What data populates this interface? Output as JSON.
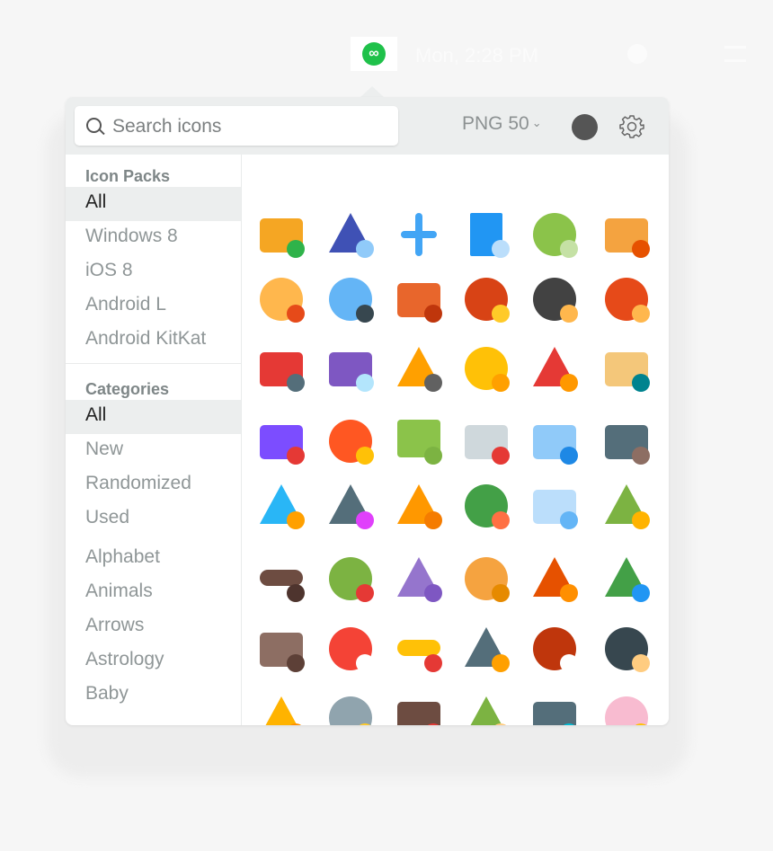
{
  "menubar": {
    "app_icon": "infinity-icon",
    "app_icon_color": "#1fc14a",
    "app_icon_glyph": "∞",
    "datetime": "Mon, 2:28 PM"
  },
  "toolbar": {
    "search_placeholder": "Search icons",
    "format": "PNG 50",
    "color_swatch": "#555555"
  },
  "sidebar": {
    "packs_heading": "Icon Packs",
    "packs": [
      {
        "label": "All",
        "selected": true
      },
      {
        "label": "Windows 8"
      },
      {
        "label": "iOS 8"
      },
      {
        "label": "Android L"
      },
      {
        "label": "Android KitKat"
      }
    ],
    "categories_heading": "Categories",
    "categories": [
      {
        "label": "All",
        "selected": true
      },
      {
        "label": "New"
      },
      {
        "label": "Randomized"
      },
      {
        "label": "Used"
      },
      {
        "label": "Alphabet"
      },
      {
        "label": "Animals"
      },
      {
        "label": "Arrows"
      },
      {
        "label": "Astrology"
      },
      {
        "label": "Baby"
      }
    ]
  },
  "icons": [
    {
      "name": "add-ticket-icon",
      "c1": "#f5a623",
      "c2": "#2fb34a",
      "shape": "rect"
    },
    {
      "name": "megaphone-icon",
      "c1": "#3f51b5",
      "c2": "#90caf9",
      "shape": "tri"
    },
    {
      "name": "airplane-icon",
      "c1": "#42a5f5",
      "c2": "#1e88e5",
      "shape": "plane"
    },
    {
      "name": "document-exclamation-icon",
      "c1": "#2196f3",
      "c2": "#bbdefb",
      "shape": "doc"
    },
    {
      "name": "verified-badge-icon",
      "c1": "#8bc34a",
      "c2": "#c5e1a5",
      "shape": "circle"
    },
    {
      "name": "colosseum-icon",
      "c1": "#f4a340",
      "c2": "#e65100",
      "shape": "rect"
    },
    {
      "name": "customer-support-icon",
      "c1": "#ffb74d",
      "c2": "#e64a19",
      "shape": "circle"
    },
    {
      "name": "astronaut-icon",
      "c1": "#64b5f6",
      "c2": "#37474f",
      "shape": "circle"
    },
    {
      "name": "briefcase-icon",
      "c1": "#e8662c",
      "c2": "#bf360c",
      "shape": "rect"
    },
    {
      "name": "bull-icon",
      "c1": "#d84315",
      "c2": "#ffca28",
      "shape": "circle"
    },
    {
      "name": "businessman-icon",
      "c1": "#424242",
      "c2": "#ffb74d",
      "shape": "circle"
    },
    {
      "name": "businesswoman-icon",
      "c1": "#e64a19",
      "c2": "#ffb74d",
      "shape": "circle"
    },
    {
      "name": "car-pushing-icon",
      "c1": "#e53935",
      "c2": "#546e7a",
      "shape": "rect"
    },
    {
      "name": "cash-register-icon",
      "c1": "#7e57c2",
      "c2": "#b3e5fc",
      "shape": "rect"
    },
    {
      "name": "chainsaw-icon",
      "c1": "#ffa000",
      "c2": "#616161",
      "shape": "tri"
    },
    {
      "name": "coin-icon",
      "c1": "#ffc107",
      "c2": "#ffa000",
      "shape": "circle"
    },
    {
      "name": "chili-pepper-icon",
      "c1": "#e53935",
      "c2": "#ff9800",
      "shape": "tri"
    },
    {
      "name": "church-icon",
      "c1": "#f4c77a",
      "c2": "#00838f",
      "shape": "rect"
    },
    {
      "name": "train-icon",
      "c1": "#7c4dff",
      "c2": "#e53935",
      "shape": "rect"
    },
    {
      "name": "comet-icon",
      "c1": "#ff5722",
      "c2": "#ffc107",
      "shape": "circle"
    },
    {
      "name": "speech-bubble-icon",
      "c1": "#8bc34a",
      "c2": "#7cb342",
      "shape": "bubble"
    },
    {
      "name": "game-controller-icon",
      "c1": "#cfd8dc",
      "c2": "#e53935",
      "shape": "rect"
    },
    {
      "name": "office-building-icon",
      "c1": "#90caf9",
      "c2": "#1e88e5",
      "shape": "rect"
    },
    {
      "name": "video-camera-icon",
      "c1": "#546e7a",
      "c2": "#8d6e63",
      "shape": "rect"
    },
    {
      "name": "hand-fan-icon",
      "c1": "#29b6f6",
      "c2": "#ffa000",
      "shape": "tri"
    },
    {
      "name": "magic-wand-icon",
      "c1": "#546e7a",
      "c2": "#e040fb",
      "shape": "tri"
    },
    {
      "name": "filter-icon",
      "c1": "#ff9800",
      "c2": "#f57c00",
      "shape": "tri"
    },
    {
      "name": "tyrolean-hat-icon",
      "c1": "#43a047",
      "c2": "#ff7043",
      "shape": "circle"
    },
    {
      "name": "keyboard-icon",
      "c1": "#bbdefb",
      "c2": "#64b5f6",
      "shape": "rect"
    },
    {
      "name": "palm-branch-icon",
      "c1": "#7cb342",
      "c2": "#ffb300",
      "shape": "tri"
    },
    {
      "name": "mustache-icon",
      "c1": "#6d4c41",
      "c2": "#4e342e",
      "shape": "flat"
    },
    {
      "name": "ninja-turtle-icon",
      "c1": "#7cb342",
      "c2": "#e53935",
      "shape": "circle"
    },
    {
      "name": "origami-swan-icon",
      "c1": "#9575cd",
      "c2": "#7e57c2",
      "shape": "tri"
    },
    {
      "name": "pretzel-icon",
      "c1": "#f5a340",
      "c2": "#e68a00",
      "shape": "circle"
    },
    {
      "name": "pyramids-icon",
      "c1": "#e65100",
      "c2": "#ff8f00",
      "shape": "tri"
    },
    {
      "name": "umbrella-icon",
      "c1": "#43a047",
      "c2": "#2196f3",
      "shape": "tri"
    },
    {
      "name": "sagrada-familia-icon",
      "c1": "#8d6e63",
      "c2": "#5d4037",
      "shape": "rect"
    },
    {
      "name": "power-button-icon",
      "c1": "#f44336",
      "c2": "#ffffff",
      "shape": "circle"
    },
    {
      "name": "sombrero-icon",
      "c1": "#ffc107",
      "c2": "#e53935",
      "shape": "flat"
    },
    {
      "name": "shovel-icon",
      "c1": "#546e7a",
      "c2": "#ffa000",
      "shape": "tri"
    },
    {
      "name": "american-football-icon",
      "c1": "#bf360c",
      "c2": "#ffffff",
      "shape": "circle"
    },
    {
      "name": "sushi-icon",
      "c1": "#37474f",
      "c2": "#ffcc80",
      "shape": "circle"
    },
    {
      "name": "highlighter-icon",
      "c1": "#ffb300",
      "c2": "#ff8f00",
      "shape": "tri"
    },
    {
      "name": "viking-helmet-icon",
      "c1": "#90a4ae",
      "c2": "#ffca28",
      "shape": "circle"
    },
    {
      "name": "viking-ship-icon",
      "c1": "#6d4c41",
      "c2": "#e53935",
      "shape": "rect"
    },
    {
      "name": "cactus-icon",
      "c1": "#7cb342",
      "c2": "#ffcc80",
      "shape": "tri"
    },
    {
      "name": "payment-terminal-icon",
      "c1": "#546e7a",
      "c2": "#00bcd4",
      "shape": "rect"
    },
    {
      "name": "piggy-bank-icon",
      "c1": "#f8bbd0",
      "c2": "#ffc107",
      "shape": "circle"
    }
  ]
}
